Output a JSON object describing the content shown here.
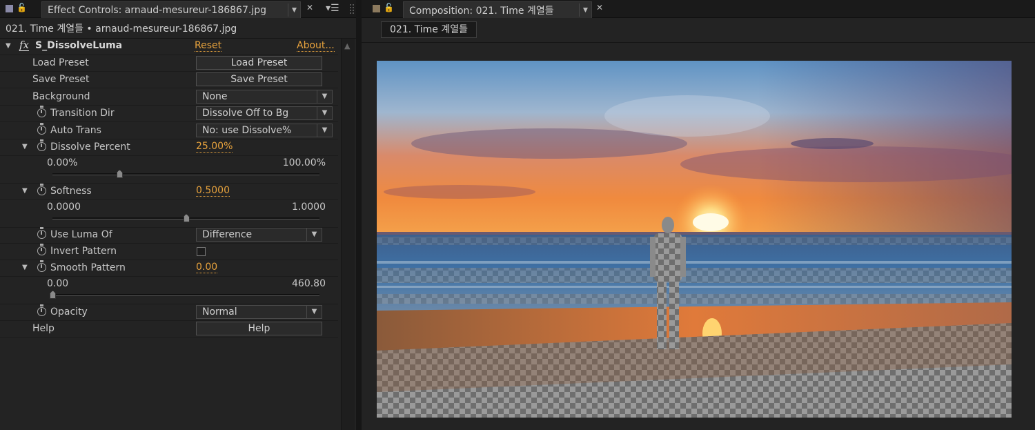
{
  "effect_controls": {
    "tab_title": "Effect Controls: arnaud-mesureur-186867.jpg",
    "breadcrumb": "021. Time 계열들 • arnaud-mesureur-186867.jpg",
    "effect": {
      "name": "S_DissolveLuma",
      "reset_label": "Reset",
      "about_label": "About..."
    },
    "params": {
      "load_preset": {
        "label": "Load Preset",
        "button": "Load Preset"
      },
      "save_preset": {
        "label": "Save Preset",
        "button": "Save Preset"
      },
      "background": {
        "label": "Background",
        "value": "None"
      },
      "transition_dir": {
        "label": "Transition Dir",
        "value": "Dissolve Off to Bg"
      },
      "auto_trans": {
        "label": "Auto Trans",
        "value": "No: use Dissolve%"
      },
      "dissolve_percent": {
        "label": "Dissolve Percent",
        "value": "25.00%",
        "min": "0.00%",
        "max": "100.00%",
        "fraction": 0.25
      },
      "softness": {
        "label": "Softness",
        "value": "0.5000",
        "min": "0.0000",
        "max": "1.0000",
        "fraction": 0.5
      },
      "use_luma_of": {
        "label": "Use Luma Of",
        "value": "Difference"
      },
      "invert_pattern": {
        "label": "Invert Pattern",
        "checked": false
      },
      "smooth_pattern": {
        "label": "Smooth Pattern",
        "value": "0.00",
        "min": "0.00",
        "max": "460.80",
        "fraction": 0.0
      },
      "opacity": {
        "label": "Opacity",
        "value": "Normal"
      },
      "help": {
        "label": "Help",
        "button": "Help"
      }
    }
  },
  "composition": {
    "tab_title": "Composition: 021. Time 계열들",
    "comp_tab": "021. Time 계열들"
  },
  "colors": {
    "accent": "#e8a33d",
    "ec_swatch": "#8a8aa8",
    "comp_swatch": "#8c7a5e"
  },
  "icons": {
    "lock": "lock-icon",
    "close": "close-icon",
    "panel_menu": "panel-menu-icon",
    "stopwatch": "stopwatch-icon",
    "fx": "fx-icon"
  }
}
